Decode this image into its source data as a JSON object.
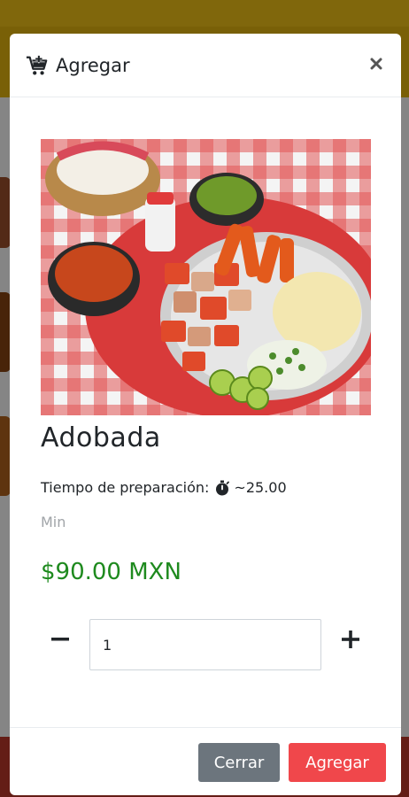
{
  "modal": {
    "title": "Agregar",
    "close_symbol": "×",
    "header_icon": "cart-plus-icon"
  },
  "product": {
    "name": "Adobada",
    "prep_label": "Tiempo de preparación:",
    "prep_icon": "stopwatch-icon",
    "prep_value": "~25.00",
    "prep_unit": "Min",
    "price": "$90.00 MXN",
    "image_alt": "food-photo"
  },
  "quantity": {
    "value": "1",
    "minus_symbol": "−",
    "plus_symbol": "+"
  },
  "footer": {
    "close_label": "Cerrar",
    "add_label": "Agregar"
  },
  "colors": {
    "price_green": "#1e8a1e",
    "add_button": "#f0474b",
    "close_button": "#6c757d",
    "topbar_yellow": "#f5c518"
  }
}
